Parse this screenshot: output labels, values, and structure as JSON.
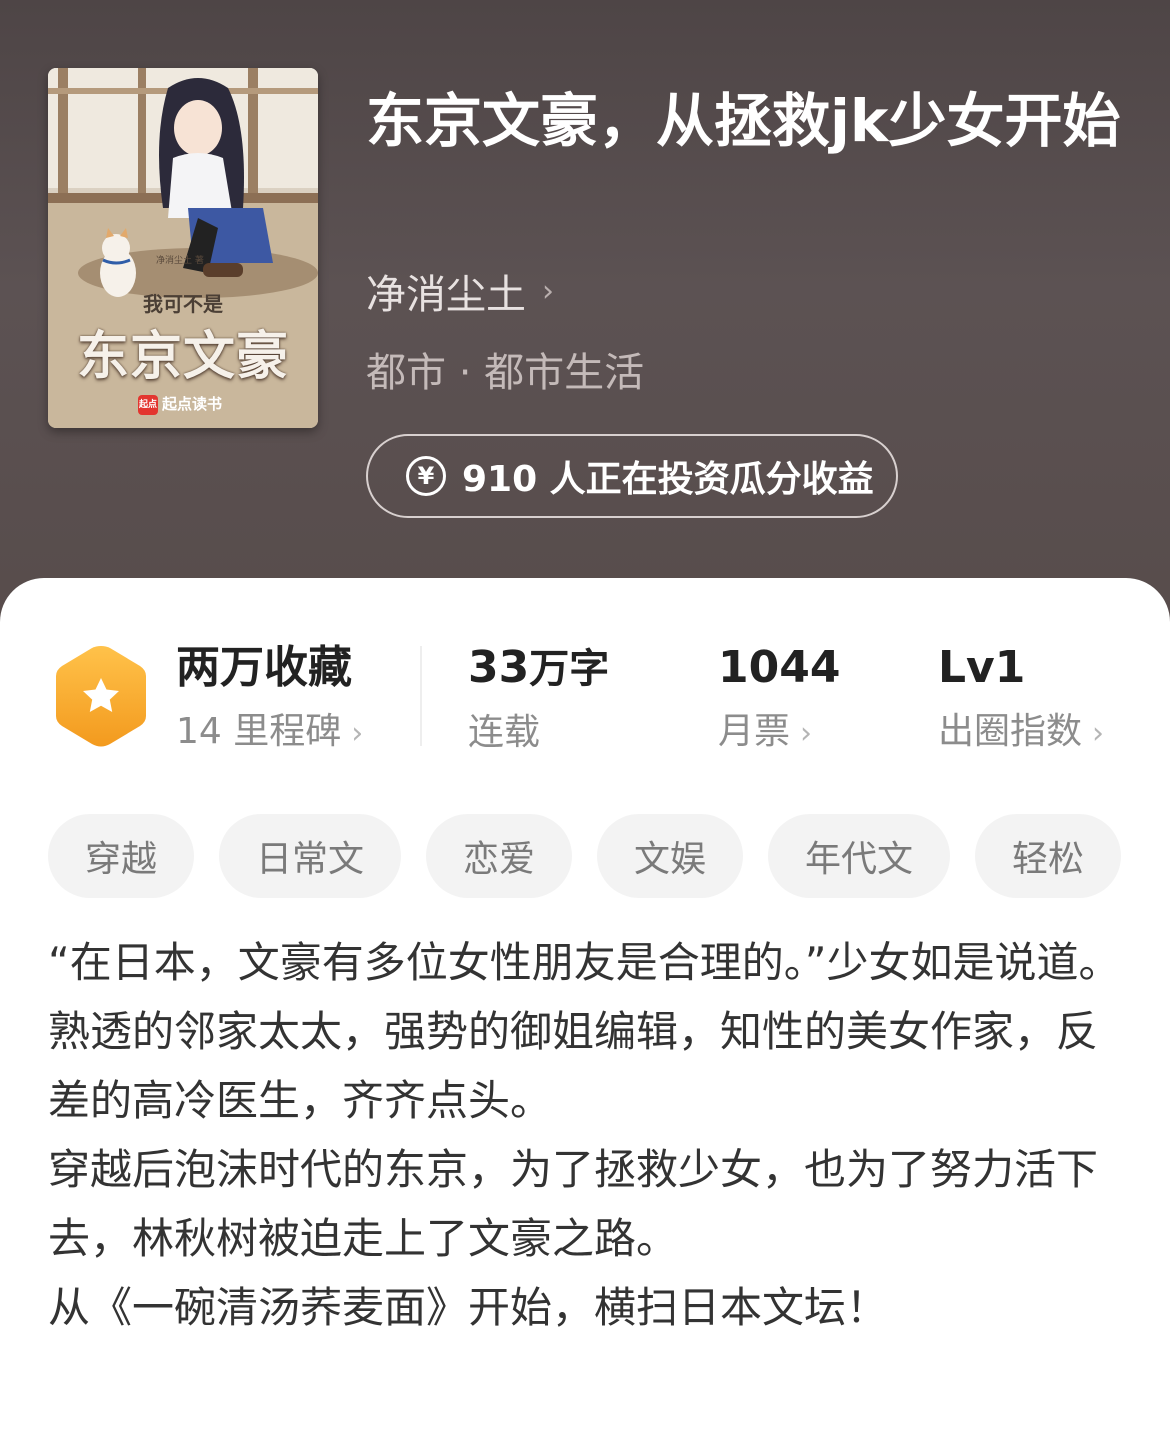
{
  "book": {
    "title": "东京文豪，从拯救jk少女开始",
    "author": "净消尘土",
    "category": "都市 · 都市生活",
    "invest_text": "910 人正在投资瓜分收益"
  },
  "cover": {
    "subtitle": "我可不是",
    "title": "东京文豪",
    "brand": "起点读书",
    "brand_logo": "起点",
    "author_mark": "净消尘土 著"
  },
  "stats": {
    "favorites": {
      "main": "两万收藏",
      "sub": "14 里程碑"
    },
    "words": {
      "number": "33",
      "unit": "万字",
      "sub": "连载"
    },
    "monthly_tickets": {
      "main": "1044",
      "sub": "月票"
    },
    "level": {
      "main": "Lv1",
      "sub": "出圈指数"
    }
  },
  "tags": [
    "穿越",
    "日常文",
    "恋爱",
    "文娱",
    "年代文",
    "轻松"
  ],
  "synopsis": [
    "“在日本，文豪有多位女性朋友是合理的。”少女如是说道。",
    "熟透的邻家太太，强势的御姐编辑，知性的美女作家，反差的高冷医生，齐齐点头。",
    "穿越后泡沫时代的东京，为了拯救少女，也为了努力活下去，林秋树被迫走上了文豪之路。",
    "从《一碗清汤荞麦面》开始，横扫日本文坛！"
  ],
  "icons": {
    "medal": "star-hexagon-icon",
    "chevron": "chevron-right-icon",
    "yen": "yen-coin-icon"
  },
  "colors": {
    "header_bg": "#574c4b",
    "medal": "#f5a623",
    "tag_bg": "#f3f3f3"
  }
}
